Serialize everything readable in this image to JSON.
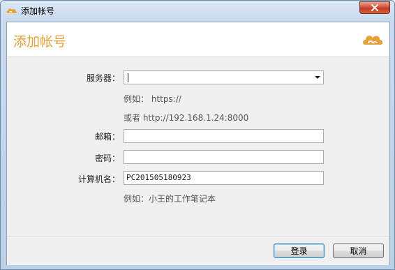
{
  "window": {
    "title": "添加帐号"
  },
  "header": {
    "title": "添加帐号",
    "logo_icon": "seafile-cloud-logo",
    "accent_color": "#e6a23c"
  },
  "form": {
    "server": {
      "label": "服务器：",
      "value": "",
      "hint_example": "例如： https://",
      "hint_or": "或者 http://192.168.1.24:8000"
    },
    "email": {
      "label": "邮箱：",
      "value": ""
    },
    "password": {
      "label": "密码：",
      "value": ""
    },
    "computer_name": {
      "label": "计算机名：",
      "value": "PC201505180923",
      "hint": "例如：小王的工作笔记本"
    }
  },
  "footer": {
    "login_label": "登录",
    "cancel_label": "取消"
  }
}
